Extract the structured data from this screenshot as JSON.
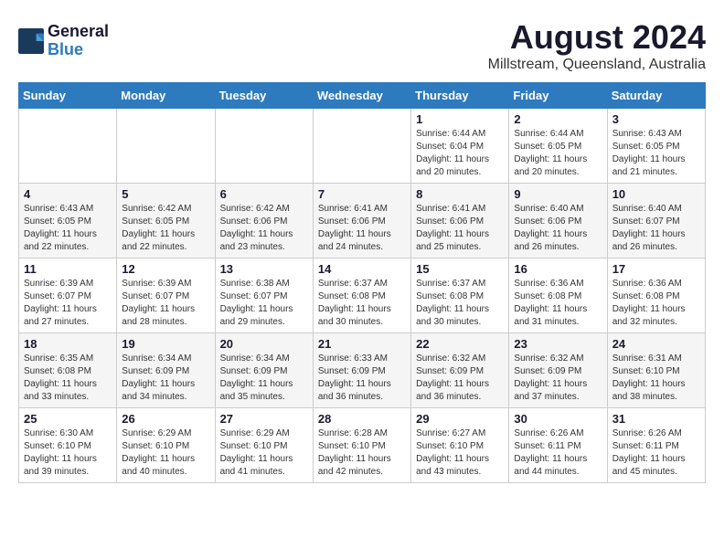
{
  "header": {
    "logo_line1": "General",
    "logo_line2": "Blue",
    "main_title": "August 2024",
    "subtitle": "Millstream, Queensland, Australia"
  },
  "calendar": {
    "days_of_week": [
      "Sunday",
      "Monday",
      "Tuesday",
      "Wednesday",
      "Thursday",
      "Friday",
      "Saturday"
    ],
    "weeks": [
      [
        {
          "day": "",
          "info": ""
        },
        {
          "day": "",
          "info": ""
        },
        {
          "day": "",
          "info": ""
        },
        {
          "day": "",
          "info": ""
        },
        {
          "day": "1",
          "info": "Sunrise: 6:44 AM\nSunset: 6:04 PM\nDaylight: 11 hours and 20 minutes."
        },
        {
          "day": "2",
          "info": "Sunrise: 6:44 AM\nSunset: 6:05 PM\nDaylight: 11 hours and 20 minutes."
        },
        {
          "day": "3",
          "info": "Sunrise: 6:43 AM\nSunset: 6:05 PM\nDaylight: 11 hours and 21 minutes."
        }
      ],
      [
        {
          "day": "4",
          "info": "Sunrise: 6:43 AM\nSunset: 6:05 PM\nDaylight: 11 hours and 22 minutes."
        },
        {
          "day": "5",
          "info": "Sunrise: 6:42 AM\nSunset: 6:05 PM\nDaylight: 11 hours and 22 minutes."
        },
        {
          "day": "6",
          "info": "Sunrise: 6:42 AM\nSunset: 6:06 PM\nDaylight: 11 hours and 23 minutes."
        },
        {
          "day": "7",
          "info": "Sunrise: 6:41 AM\nSunset: 6:06 PM\nDaylight: 11 hours and 24 minutes."
        },
        {
          "day": "8",
          "info": "Sunrise: 6:41 AM\nSunset: 6:06 PM\nDaylight: 11 hours and 25 minutes."
        },
        {
          "day": "9",
          "info": "Sunrise: 6:40 AM\nSunset: 6:06 PM\nDaylight: 11 hours and 26 minutes."
        },
        {
          "day": "10",
          "info": "Sunrise: 6:40 AM\nSunset: 6:07 PM\nDaylight: 11 hours and 26 minutes."
        }
      ],
      [
        {
          "day": "11",
          "info": "Sunrise: 6:39 AM\nSunset: 6:07 PM\nDaylight: 11 hours and 27 minutes."
        },
        {
          "day": "12",
          "info": "Sunrise: 6:39 AM\nSunset: 6:07 PM\nDaylight: 11 hours and 28 minutes."
        },
        {
          "day": "13",
          "info": "Sunrise: 6:38 AM\nSunset: 6:07 PM\nDaylight: 11 hours and 29 minutes."
        },
        {
          "day": "14",
          "info": "Sunrise: 6:37 AM\nSunset: 6:08 PM\nDaylight: 11 hours and 30 minutes."
        },
        {
          "day": "15",
          "info": "Sunrise: 6:37 AM\nSunset: 6:08 PM\nDaylight: 11 hours and 30 minutes."
        },
        {
          "day": "16",
          "info": "Sunrise: 6:36 AM\nSunset: 6:08 PM\nDaylight: 11 hours and 31 minutes."
        },
        {
          "day": "17",
          "info": "Sunrise: 6:36 AM\nSunset: 6:08 PM\nDaylight: 11 hours and 32 minutes."
        }
      ],
      [
        {
          "day": "18",
          "info": "Sunrise: 6:35 AM\nSunset: 6:08 PM\nDaylight: 11 hours and 33 minutes."
        },
        {
          "day": "19",
          "info": "Sunrise: 6:34 AM\nSunset: 6:09 PM\nDaylight: 11 hours and 34 minutes."
        },
        {
          "day": "20",
          "info": "Sunrise: 6:34 AM\nSunset: 6:09 PM\nDaylight: 11 hours and 35 minutes."
        },
        {
          "day": "21",
          "info": "Sunrise: 6:33 AM\nSunset: 6:09 PM\nDaylight: 11 hours and 36 minutes."
        },
        {
          "day": "22",
          "info": "Sunrise: 6:32 AM\nSunset: 6:09 PM\nDaylight: 11 hours and 36 minutes."
        },
        {
          "day": "23",
          "info": "Sunrise: 6:32 AM\nSunset: 6:09 PM\nDaylight: 11 hours and 37 minutes."
        },
        {
          "day": "24",
          "info": "Sunrise: 6:31 AM\nSunset: 6:10 PM\nDaylight: 11 hours and 38 minutes."
        }
      ],
      [
        {
          "day": "25",
          "info": "Sunrise: 6:30 AM\nSunset: 6:10 PM\nDaylight: 11 hours and 39 minutes."
        },
        {
          "day": "26",
          "info": "Sunrise: 6:29 AM\nSunset: 6:10 PM\nDaylight: 11 hours and 40 minutes."
        },
        {
          "day": "27",
          "info": "Sunrise: 6:29 AM\nSunset: 6:10 PM\nDaylight: 11 hours and 41 minutes."
        },
        {
          "day": "28",
          "info": "Sunrise: 6:28 AM\nSunset: 6:10 PM\nDaylight: 11 hours and 42 minutes."
        },
        {
          "day": "29",
          "info": "Sunrise: 6:27 AM\nSunset: 6:10 PM\nDaylight: 11 hours and 43 minutes."
        },
        {
          "day": "30",
          "info": "Sunrise: 6:26 AM\nSunset: 6:11 PM\nDaylight: 11 hours and 44 minutes."
        },
        {
          "day": "31",
          "info": "Sunrise: 6:26 AM\nSunset: 6:11 PM\nDaylight: 11 hours and 45 minutes."
        }
      ]
    ]
  }
}
